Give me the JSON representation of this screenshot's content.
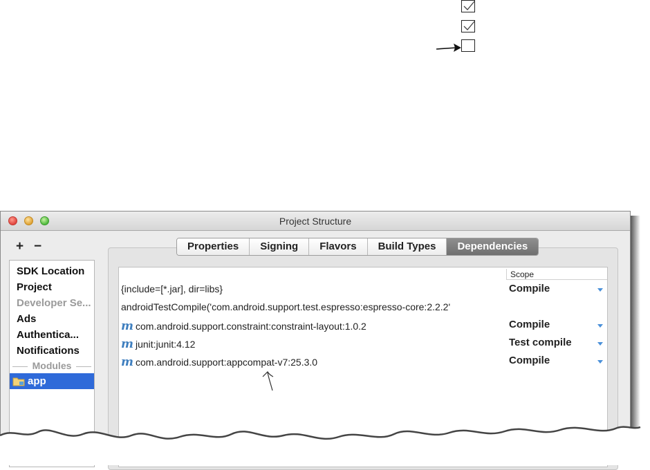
{
  "window": {
    "title": "Project Structure"
  },
  "sidebar": {
    "add_label": "+",
    "remove_label": "−",
    "items": [
      {
        "label": "SDK Location"
      },
      {
        "label": "Project"
      },
      {
        "label": "Developer Se..."
      },
      {
        "label": "Ads"
      },
      {
        "label": "Authentica..."
      },
      {
        "label": "Notifications"
      }
    ],
    "section_label": "Modules",
    "module": {
      "label": "app"
    }
  },
  "tabs": [
    {
      "label": "Properties"
    },
    {
      "label": "Signing"
    },
    {
      "label": "Flavors"
    },
    {
      "label": "Build Types"
    },
    {
      "label": "Dependencies",
      "active": true
    }
  ],
  "table": {
    "scope_header": "Scope",
    "rows": [
      {
        "dependency": "{include=[*.jar], dir=libs}",
        "scope": "Compile",
        "maven": false
      },
      {
        "dependency": "androidTestCompile('com.android.support.test.espresso:espresso-core:2.2.2'",
        "scope": "",
        "maven": false
      },
      {
        "dependency": "com.android.support.constraint:constraint-layout:1.0.2",
        "scope": "Compile",
        "maven": true
      },
      {
        "dependency": "junit:junit:4.12",
        "scope": "Test compile",
        "maven": true
      },
      {
        "dependency": "com.android.support:appcompat-v7:25.3.0",
        "scope": "Compile",
        "maven": true
      }
    ]
  },
  "annotation_checkboxes": [
    {
      "checked": true
    },
    {
      "checked": true
    },
    {
      "checked": false
    }
  ],
  "colors": {
    "selection": "#2f6ad9",
    "maven_icon": "#3f7fbf",
    "active_tab": "#7a7a7a"
  }
}
